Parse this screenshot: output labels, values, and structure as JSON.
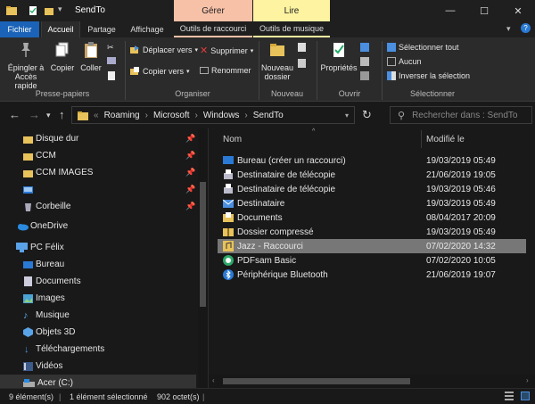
{
  "window": {
    "title": "SendTo",
    "ctx_gerer": "Gérer",
    "ctx_lire": "Lire",
    "minimize": "—",
    "maximize": "☐",
    "close": "✕"
  },
  "tabs": {
    "fichier": "Fichier",
    "accueil": "Accueil",
    "partage": "Partage",
    "affichage": "Affichage",
    "outils_raccourci": "Outils de raccourci",
    "outils_musique": "Outils de musique"
  },
  "ribbon": {
    "epingler": "Épingler à",
    "epingler2": "Accès rapide",
    "copier": "Copier",
    "coller": "Coller",
    "presse_papiers": "Presse-papiers",
    "deplacer": "Déplacer vers",
    "copier_vers": "Copier vers",
    "supprimer": "Supprimer",
    "renommer": "Renommer",
    "organiser": "Organiser",
    "nouveau_dossier": "Nouveau",
    "nouveau_dossier2": "dossier",
    "nouveau": "Nouveau",
    "proprietes": "Propriétés",
    "ouvrir": "Ouvrir",
    "selectionner_tout": "Sélectionner tout",
    "aucun": "Aucun",
    "inverser": "Inverser la sélection",
    "selectionner": "Sélectionner"
  },
  "address": {
    "crumbs": [
      "Roaming",
      "Microsoft",
      "Windows",
      "SendTo"
    ],
    "search_placeholder": "Rechercher dans : SendTo"
  },
  "nav": {
    "items": [
      {
        "label": "Disque dur",
        "pinned": true
      },
      {
        "label": "CCM",
        "pinned": true
      },
      {
        "label": "CCM IMAGES",
        "pinned": true
      },
      {
        "label": "",
        "pinned": true
      },
      {
        "label": "Corbeille",
        "pinned": true
      },
      {
        "label": "OneDrive"
      },
      {
        "label": "PC Félix"
      },
      {
        "label": "Bureau"
      },
      {
        "label": "Documents"
      },
      {
        "label": "Images"
      },
      {
        "label": "Musique"
      },
      {
        "label": "Objets 3D"
      },
      {
        "label": "Téléchargements"
      },
      {
        "label": "Vidéos"
      },
      {
        "label": "Acer (C:)"
      }
    ]
  },
  "files": {
    "col_name": "Nom",
    "col_date": "Modifié le",
    "rows": [
      {
        "name": "Bureau (créer un raccourci)",
        "date": "19/03/2019 05:49"
      },
      {
        "name": "Destinataire de télécopie",
        "date": "21/06/2019 19:05"
      },
      {
        "name": "Destinataire de télécopie",
        "date": "19/03/2019 05:46"
      },
      {
        "name": "Destinataire",
        "date": "19/03/2019 05:49"
      },
      {
        "name": "Documents",
        "date": "08/04/2017 20:09"
      },
      {
        "name": "Dossier compressé",
        "date": "19/03/2019 05:49"
      },
      {
        "name": "Jazz - Raccourci",
        "date": "07/02/2020 14:32"
      },
      {
        "name": "PDFsam Basic",
        "date": "07/02/2020 10:05"
      },
      {
        "name": "Périphérique Bluetooth",
        "date": "21/06/2019 19:07"
      }
    ]
  },
  "status": {
    "count": "9 élément(s)",
    "selected": "1 élément sélectionné",
    "size": "902 octet(s)"
  },
  "colors": {
    "accent": "#1a63b8",
    "ctx_gerer": "#f7c1a8",
    "ctx_lire": "#fdf3a0",
    "folder": "#e8c25a"
  }
}
